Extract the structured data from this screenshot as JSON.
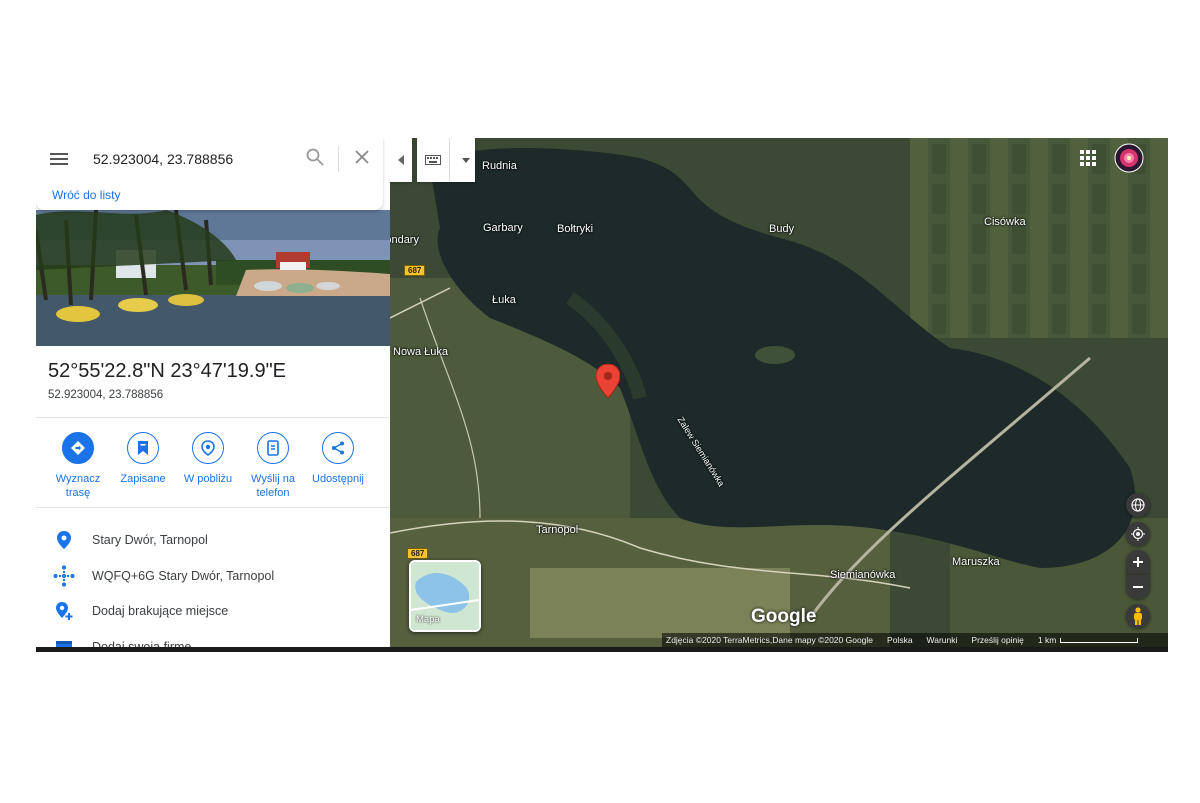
{
  "search": {
    "query": "52.923004, 23.788856"
  },
  "back_link": "Wróć do listy",
  "place": {
    "title": "52°55'22.8\"N 23°47'19.9\"E",
    "subtitle": "52.923004, 23.788856"
  },
  "actions": [
    {
      "label": "Wyznacz trasę",
      "icon": "directions-icon"
    },
    {
      "label": "Zapisane",
      "icon": "bookmark-icon"
    },
    {
      "label": "W pobliżu",
      "icon": "nearby-icon"
    },
    {
      "label": "Wyślij na telefon",
      "icon": "send-to-phone-icon"
    },
    {
      "label": "Udostępnij",
      "icon": "share-icon"
    }
  ],
  "details": [
    {
      "text": "Stary Dwór, Tarnopol",
      "icon": "location-pin-icon"
    },
    {
      "text": "WQFQ+6G Stary Dwór, Tarnopol",
      "icon": "plus-code-icon"
    },
    {
      "text": "Dodaj brakujące miejsce",
      "icon": "add-place-icon"
    },
    {
      "text": "Dodaj swoją firmę",
      "icon": "business-icon"
    }
  ],
  "map_labels": {
    "rudnia": "Rudnia",
    "bondary": "Bondary",
    "garbary": "Garbary",
    "boltryki": "Bołtryki",
    "budy": "Budy",
    "cisowka": "Cisówka",
    "luka": "Łuka",
    "nowa_luka": "Nowa Łuka",
    "zalew": "Zalew Siemianówka",
    "tarnopol": "Tarnopol",
    "maruszka": "Maruszka",
    "siemianowka": "Siemianówka",
    "road_687_a": "687",
    "road_687_b": "687",
    "google": "Google",
    "mapa": "Mapa"
  },
  "attribution": {
    "data": "Zdjęcia ©2020 TerraMetrics,Dane mapy ©2020 Google",
    "country": "Polska",
    "terms": "Warunki",
    "feedback": "Prześlij opinię",
    "scale": "1 km"
  },
  "colors": {
    "accent": "#1a73e8",
    "marker": "#ea4335"
  }
}
